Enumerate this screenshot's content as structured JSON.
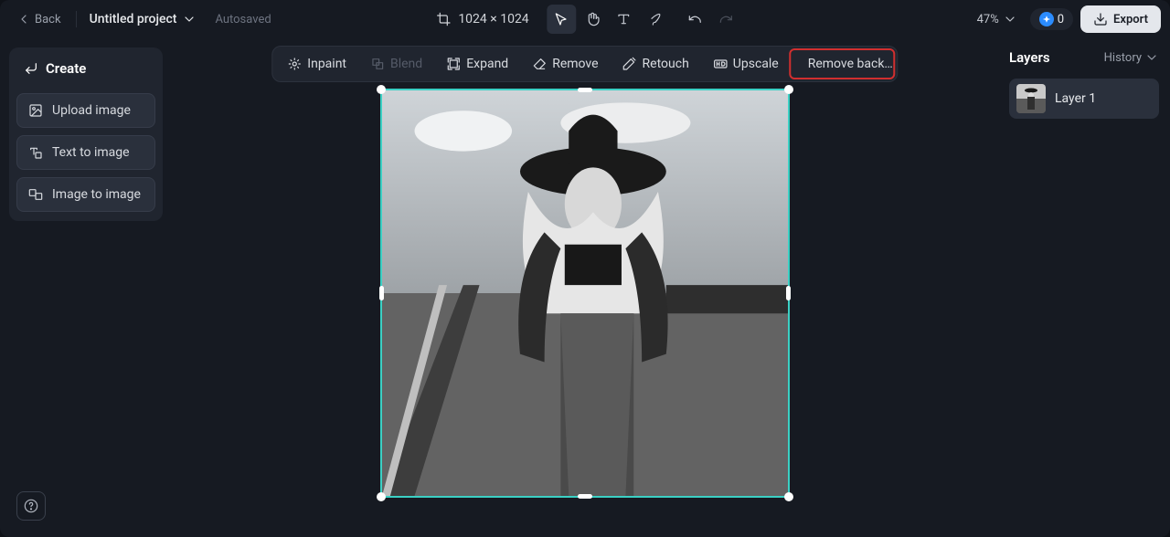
{
  "header": {
    "back_label": "Back",
    "project_title": "Untitled project",
    "save_status": "Autosaved",
    "dimensions": "1024 × 1024",
    "zoom_label": "47%",
    "credits": "0",
    "export_label": "Export"
  },
  "context_tools": {
    "inpaint": "Inpaint",
    "blend": "Blend",
    "expand": "Expand",
    "remove": "Remove",
    "retouch": "Retouch",
    "upscale": "Upscale",
    "remove_bg": "Remove back…"
  },
  "left": {
    "create_title": "Create",
    "items": [
      {
        "label": "Upload image"
      },
      {
        "label": "Text to image"
      },
      {
        "label": "Image to image"
      }
    ]
  },
  "right": {
    "layers_title": "Layers",
    "history_label": "History",
    "layers": [
      {
        "name": "Layer 1"
      }
    ]
  },
  "canvas": {
    "image_desc": "Black-and-white photo of a woman wearing a cowboy hat, crop top and denim jacket, standing by railroad tracks"
  }
}
